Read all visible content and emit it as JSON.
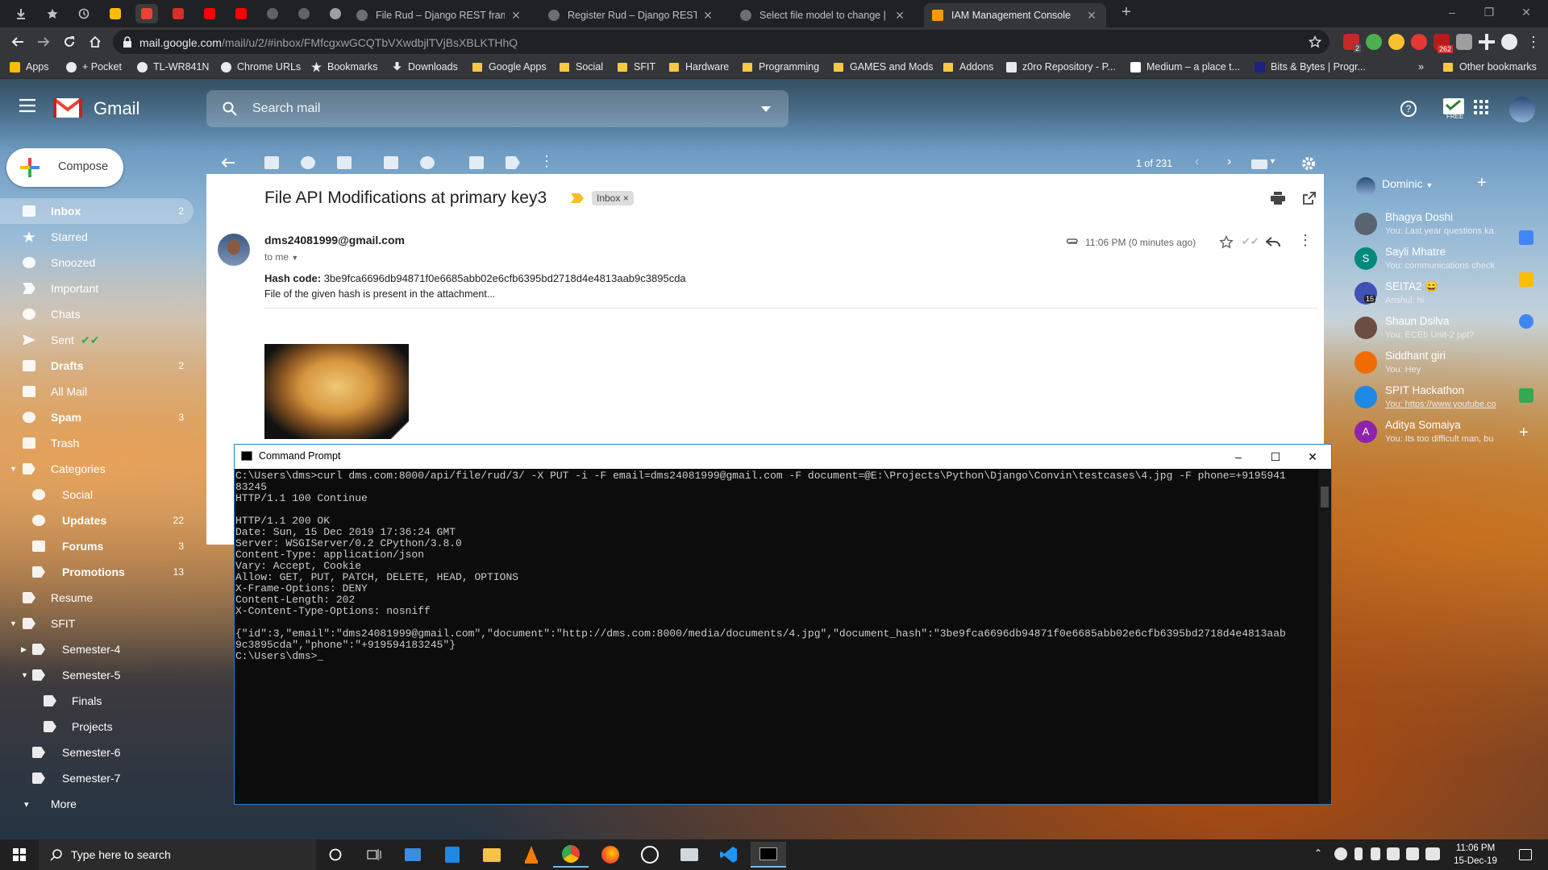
{
  "browser": {
    "tabs": [
      {
        "title": "File Rud – Django REST framewo",
        "color": "#2b2b2b"
      },
      {
        "title": "Register Rud – Django REST fran",
        "color": "#2b2b2b"
      },
      {
        "title": "Select file model to change | Dja",
        "color": "#2b2b2b"
      },
      {
        "title": "IAM Management Console",
        "color": "#ff9900"
      }
    ],
    "url_domain": "mail.google.com",
    "url_path": "/mail/u/2/#inbox/FMfcgxwGCQTbVXwdbjlTVjBsXBLKTHhQ",
    "ext_badges": {
      "abp": "2",
      "red": "262"
    },
    "bookmarks": [
      "Apps",
      "+ Pocket",
      "TL-WR841N",
      "Chrome URLs",
      "Bookmarks",
      "Downloads",
      "Google Apps",
      "Social",
      "SFIT",
      "Hardware",
      "Programming",
      "GAMES and Mods",
      "Addons",
      "z0ro Repository - P...",
      "Medium – a place t...",
      "Bits & Bytes | Progr..."
    ],
    "other_bookmarks": "Other bookmarks",
    "more": "»"
  },
  "gmail": {
    "app_name": "Gmail",
    "search_placeholder": "Search mail",
    "compose": "Compose",
    "pager": "1 of 231",
    "free_label": "FREE",
    "nav": [
      {
        "label": "Inbox",
        "count": "2"
      },
      {
        "label": "Starred",
        "count": ""
      },
      {
        "label": "Snoozed",
        "count": ""
      },
      {
        "label": "Important",
        "count": ""
      },
      {
        "label": "Chats",
        "count": ""
      },
      {
        "label": "Sent",
        "count": ""
      },
      {
        "label": "Drafts",
        "count": "2"
      },
      {
        "label": "All Mail",
        "count": ""
      },
      {
        "label": "Spam",
        "count": "3"
      },
      {
        "label": "Trash",
        "count": ""
      },
      {
        "label": "Categories",
        "count": ""
      },
      {
        "label": "Social",
        "count": ""
      },
      {
        "label": "Updates",
        "count": "22"
      },
      {
        "label": "Forums",
        "count": "3"
      },
      {
        "label": "Promotions",
        "count": "13"
      },
      {
        "label": "Resume",
        "count": ""
      },
      {
        "label": "SFIT",
        "count": ""
      },
      {
        "label": "Semester-4",
        "count": ""
      },
      {
        "label": "Semester-5",
        "count": ""
      },
      {
        "label": "Finals",
        "count": ""
      },
      {
        "label": "Projects",
        "count": ""
      },
      {
        "label": "Semester-6",
        "count": ""
      },
      {
        "label": "Semester-7",
        "count": ""
      },
      {
        "label": "More",
        "count": ""
      }
    ],
    "email": {
      "subject": "File API Modifications at primary key3",
      "label": "Inbox",
      "label_remove": "×",
      "sender": "dms24081999@gmail.com",
      "to": "to me",
      "time": "11:06 PM (0 minutes ago)",
      "hash_label": "Hash code:",
      "hash": "3be9fca6696db94871f0e6685abb02e6cfb6395bd2718d4e4813aab9c3895cda",
      "body": "File of the given hash is present in the attachment..."
    },
    "chat": {
      "me": "Dominic",
      "contacts": [
        {
          "name": "Bhagya Doshi",
          "msg": "You: Last year questions ka",
          "color": "#5a6470"
        },
        {
          "name": "Sayli Mhatre",
          "msg": "You: communications check",
          "color": "#00897b",
          "initial": "S"
        },
        {
          "name": "SEITA2 😄",
          "msg": "Anshul: hi",
          "color": "#3f51b5",
          "badge": "15"
        },
        {
          "name": "Shaun Dsilva",
          "msg": "You: ECEb Unit-2 ppt?",
          "color": "#6d4c41"
        },
        {
          "name": "Siddhant giri",
          "msg": "You: Hey",
          "color": "#ef6c00"
        },
        {
          "name": "SPIT Hackathon",
          "msg": "You: https://www.youtube.co",
          "color": "#1e88e5"
        },
        {
          "name": "Aditya Somaiya",
          "msg": "You: Its too difficult man, bu",
          "color": "#8e24aa",
          "initial": "A"
        }
      ]
    }
  },
  "cmd": {
    "title": "Command Prompt",
    "lines": [
      "C:\\Users\\dms>curl dms.com:8000/api/file/rud/3/ -X PUT -i -F email=dms24081999@gmail.com -F document=@E:\\Projects\\Python\\Django\\Convin\\testcases\\4.jpg -F phone=+9195941",
      "83245",
      "HTTP/1.1 100 Continue",
      "",
      "HTTP/1.1 200 OK",
      "Date: Sun, 15 Dec 2019 17:36:24 GMT",
      "Server: WSGIServer/0.2 CPython/3.8.0",
      "Content-Type: application/json",
      "Vary: Accept, Cookie",
      "Allow: GET, PUT, PATCH, DELETE, HEAD, OPTIONS",
      "X-Frame-Options: DENY",
      "Content-Length: 202",
      "X-Content-Type-Options: nosniff",
      "",
      "{\"id\":3,\"email\":\"dms24081999@gmail.com\",\"document\":\"http://dms.com:8000/media/documents/4.jpg\",\"document_hash\":\"3be9fca6696db94871f0e6685abb02e6cfb6395bd2718d4e4813aab",
      "9c3895cda\",\"phone\":\"+919594183245\"}",
      "C:\\Users\\dms>_"
    ]
  },
  "taskbar": {
    "search_placeholder": "Type here to search",
    "time": "11:06 PM",
    "date": "15-Dec-19"
  }
}
